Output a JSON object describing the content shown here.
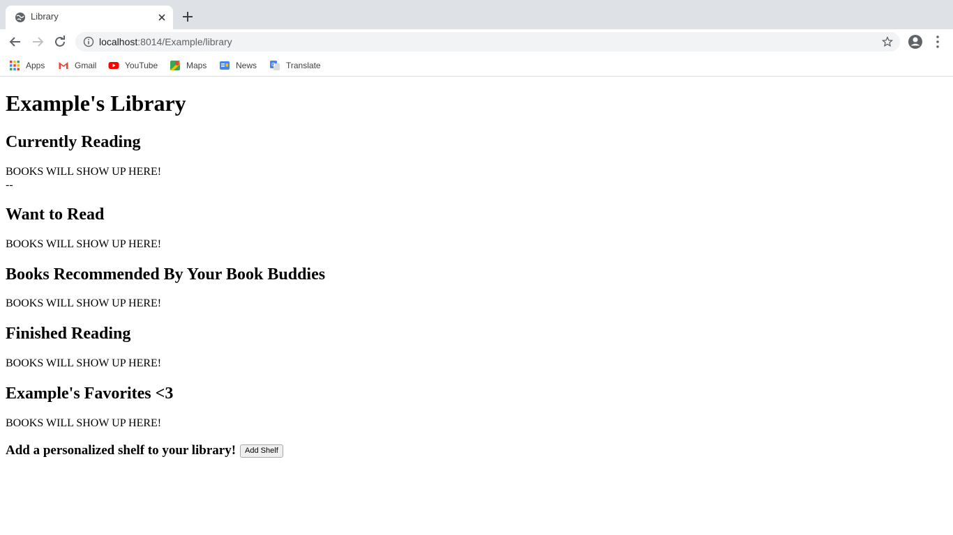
{
  "browser": {
    "tab": {
      "title": "Library"
    },
    "address": {
      "host": "localhost",
      "rest": ":8014/Example/library"
    },
    "bookmarks": [
      {
        "label": "Apps",
        "icon": "apps-grid-icon"
      },
      {
        "label": "Gmail",
        "icon": "gmail-icon"
      },
      {
        "label": "YouTube",
        "icon": "youtube-icon"
      },
      {
        "label": "Maps",
        "icon": "maps-icon"
      },
      {
        "label": "News",
        "icon": "news-icon"
      },
      {
        "label": "Translate",
        "icon": "translate-icon"
      }
    ]
  },
  "page": {
    "title": "Example's Library",
    "sections": [
      {
        "heading": "Currently Reading",
        "text": "BOOKS WILL SHOW UP HERE!",
        "extra": "--"
      },
      {
        "heading": "Want to Read",
        "text": "BOOKS WILL SHOW UP HERE!"
      },
      {
        "heading": "Books Recommended By Your Book Buddies",
        "text": "BOOKS WILL SHOW UP HERE!"
      },
      {
        "heading": "Finished Reading",
        "text": "BOOKS WILL SHOW UP HERE!"
      },
      {
        "heading": "Example's Favorites <3",
        "text": "BOOKS WILL SHOW UP HERE!"
      }
    ],
    "add_shelf": {
      "label": "Add a personalized shelf to your library!",
      "button": "Add Shelf"
    }
  },
  "colors": {
    "tabstrip": "#dee1e6",
    "omnibox": "#f1f3f4",
    "icon": "#5f6368"
  }
}
